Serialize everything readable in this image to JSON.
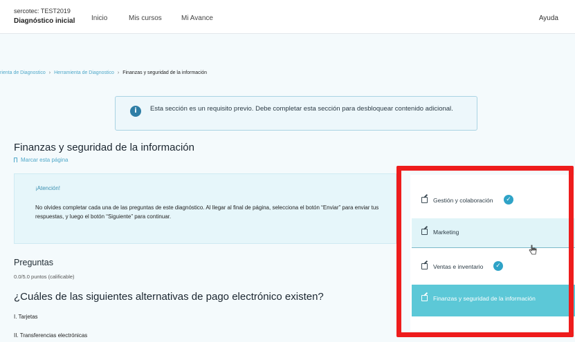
{
  "header": {
    "course_org": "sercotec: TEST2019",
    "course_title": "Diagnóstico inicial",
    "nav": [
      "Inicio",
      "Mis cursos",
      "Mi Avance"
    ],
    "help": "Ayuda"
  },
  "breadcrumb": {
    "items": [
      "rienta de Diagnostico",
      "Herramienta de Diagnostico"
    ],
    "separator": "›",
    "current": "Finanzas y seguridad de la información"
  },
  "notice": {
    "icon": "info-icon",
    "text": "Esta sección es un requisito previo. Debe completar esta sección para desbloquear contenido adicional."
  },
  "section": {
    "title": "Finanzas y seguridad de la información",
    "bookmark": "Marcar esta página"
  },
  "attention": {
    "title": "¡Atención!",
    "body": "No olvides completar cada una de las preguntas de este diagnóstico. Al llegar al final de página, selecciona el botón “Enviar” para enviar tus respuestas, y luego el botón “Siguiente” para continuar."
  },
  "questions": {
    "label": "Preguntas",
    "points": "0.0/5.0 puntos (calificable)",
    "question": "¿Cuáles de las siguientes alternativas de pago electrónico existen?",
    "answers": [
      "I. Tarjetas",
      "II. Transferencias electrónicas"
    ]
  },
  "units": [
    {
      "label": "Gestión y colaboración",
      "completed": true
    },
    {
      "label": "Marketing",
      "completed": false
    },
    {
      "label": "Ventas e inventario",
      "completed": true
    },
    {
      "label": "Finanzas y seguridad de la información",
      "completed": false
    }
  ],
  "colors": {
    "accent": "#2fa3c7",
    "active_unit": "#5cc8d7",
    "highlight": "#ee1c1c"
  }
}
